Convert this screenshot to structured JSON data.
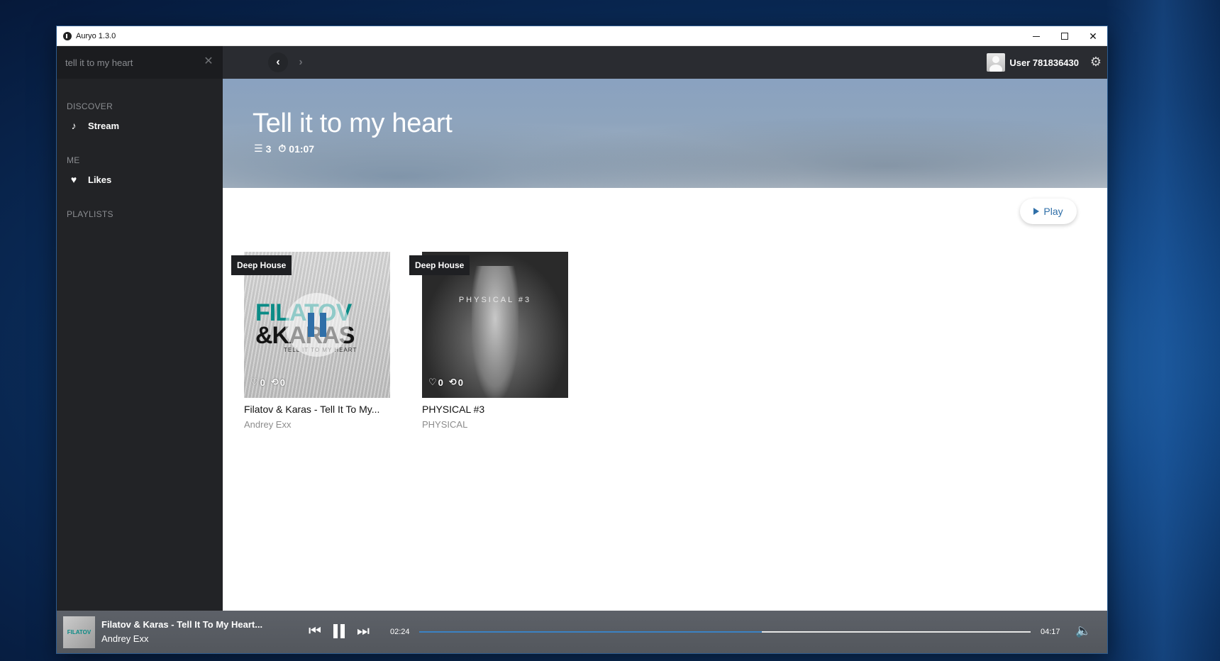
{
  "window": {
    "title": "Auryo 1.3.0",
    "controls": [
      "minimize",
      "maximize",
      "close"
    ]
  },
  "search": {
    "value": "tell it to my heart",
    "clear_icon": "close-icon"
  },
  "sidebar": {
    "sections": [
      {
        "heading": "DISCOVER",
        "items": [
          {
            "label": "Stream",
            "icon": "music-note-icon"
          }
        ]
      },
      {
        "heading": "ME",
        "items": [
          {
            "label": "Likes",
            "icon": "heart-icon"
          }
        ]
      },
      {
        "heading": "PLAYLISTS",
        "items": []
      }
    ]
  },
  "topbar": {
    "username": "User 781836430"
  },
  "playlist": {
    "title": "Tell it to my heart",
    "track_count": "3",
    "duration": "01:07",
    "play_label": "Play"
  },
  "tracks": [
    {
      "genre": "Deep House",
      "title": "Filatov & Karas - Tell It To My...",
      "artist": "Andrey Exx",
      "likes": "0",
      "reposts": "0",
      "art_logo_line1": "FILATOV",
      "art_logo_line2": "&KARAS",
      "art_subtitle": "TELL IT TO MY HEART",
      "playing": true
    },
    {
      "genre": "Deep House",
      "title": "PHYSICAL #3",
      "artist": "PHYSICAL",
      "likes": "0",
      "reposts": "0",
      "art_text": "PHYSICAL #3",
      "playing": false
    }
  ],
  "player": {
    "title": "Filatov & Karas - Tell It To My Heart...",
    "artist": "Andrey Exx",
    "current_time": "02:24",
    "total_time": "04:17",
    "progress_fraction": 0.56,
    "accent_color": "#3b82c4"
  }
}
